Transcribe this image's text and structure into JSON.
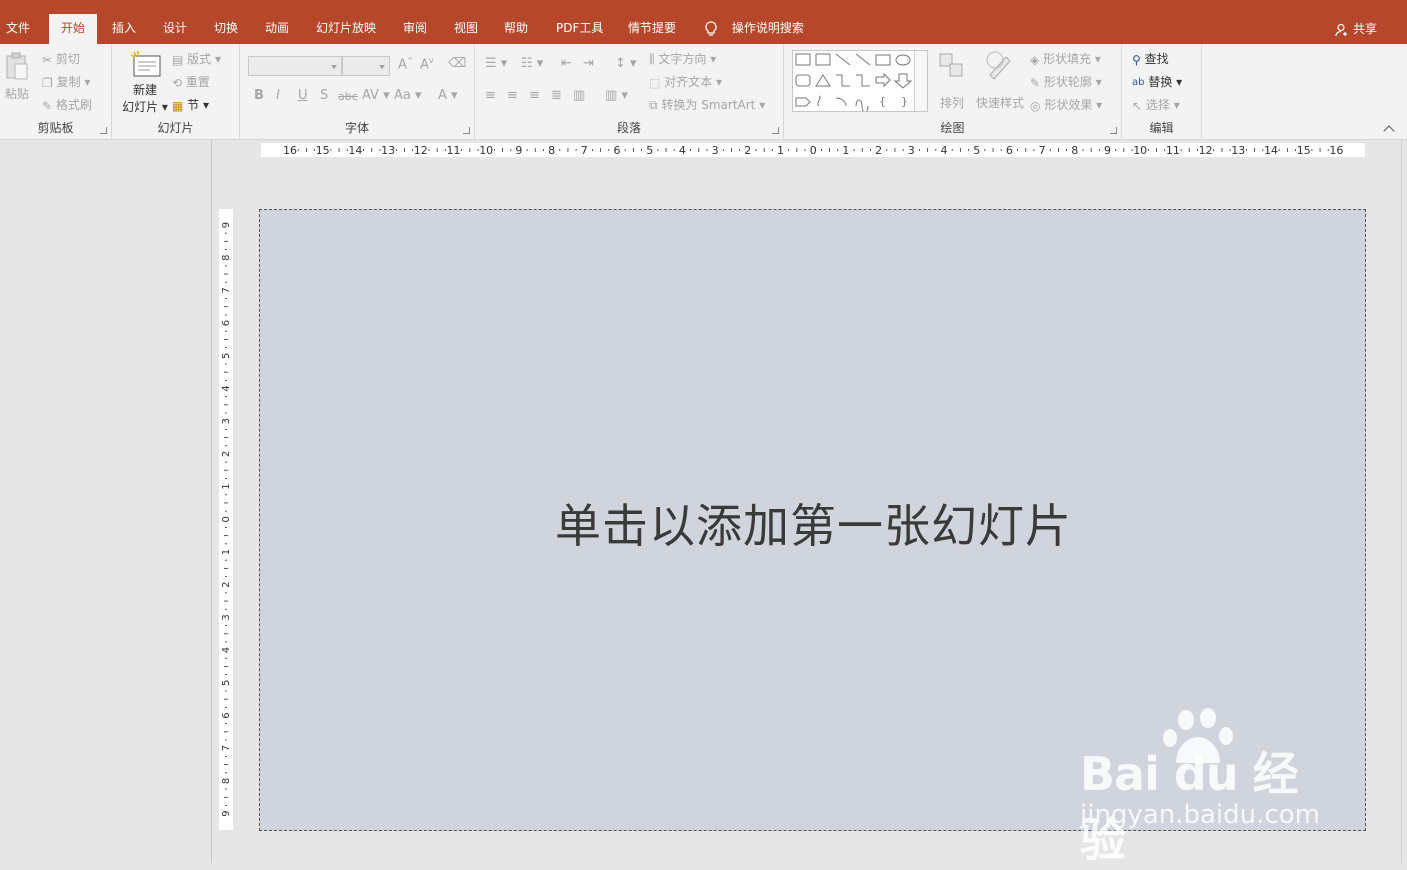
{
  "tabs": {
    "file": "文件",
    "home": "开始",
    "insert": "插入",
    "design": "设计",
    "transitions": "切换",
    "animations": "动画",
    "slideshow": "幻灯片放映",
    "review": "审阅",
    "view": "视图",
    "help": "帮助",
    "pdf": "PDF工具",
    "plot": "情节提要",
    "search": "操作说明搜索",
    "share": "共享"
  },
  "clipboard": {
    "label": "剪贴板",
    "paste": "粘贴",
    "cut": "剪切",
    "copy": "复制",
    "format_painter": "格式刷"
  },
  "slides": {
    "label": "幻灯片",
    "new_slide_line1": "新建",
    "new_slide_line2": "幻灯片",
    "layout": "版式",
    "reset": "重置",
    "section": "节"
  },
  "font": {
    "label": "字体",
    "bold": "B",
    "italic": "I",
    "underline": "U",
    "shadow": "S",
    "strike": "abc",
    "spacing": "AV",
    "case": "Aa",
    "color": "A"
  },
  "paragraph": {
    "label": "段落",
    "text_direction": "文字方向",
    "align_text": "对齐文本",
    "smartart": "转换为 SmartArt"
  },
  "drawing": {
    "label": "绘图",
    "arrange": "排列",
    "quick_styles": "快速样式",
    "shape_fill": "形状填充",
    "shape_outline": "形状轮廓",
    "shape_effects": "形状效果"
  },
  "editing": {
    "label": "编辑",
    "find": "查找",
    "replace": "替换",
    "select": "选择"
  },
  "ruler": {
    "h": [
      "16",
      "15",
      "14",
      "13",
      "12",
      "11",
      "10",
      "9",
      "8",
      "7",
      "6",
      "5",
      "4",
      "3",
      "2",
      "1",
      "0",
      "1",
      "2",
      "3",
      "4",
      "5",
      "6",
      "7",
      "8",
      "9",
      "10",
      "11",
      "12",
      "13",
      "14",
      "15",
      "16"
    ],
    "v": [
      "9",
      "8",
      "7",
      "6",
      "5",
      "4",
      "3",
      "2",
      "1",
      "0",
      "1",
      "2",
      "3",
      "4",
      "5",
      "6",
      "7",
      "8",
      "9"
    ]
  },
  "slide": {
    "placeholder": "单击以添加第一张幻灯片"
  },
  "watermark": {
    "brand": "Bai du 经验",
    "site": "jingyan.baidu.com"
  },
  "colors": {
    "accent": "#b7472a",
    "ribbon": "#f3f3f3",
    "slide": "#d0d4dc"
  }
}
